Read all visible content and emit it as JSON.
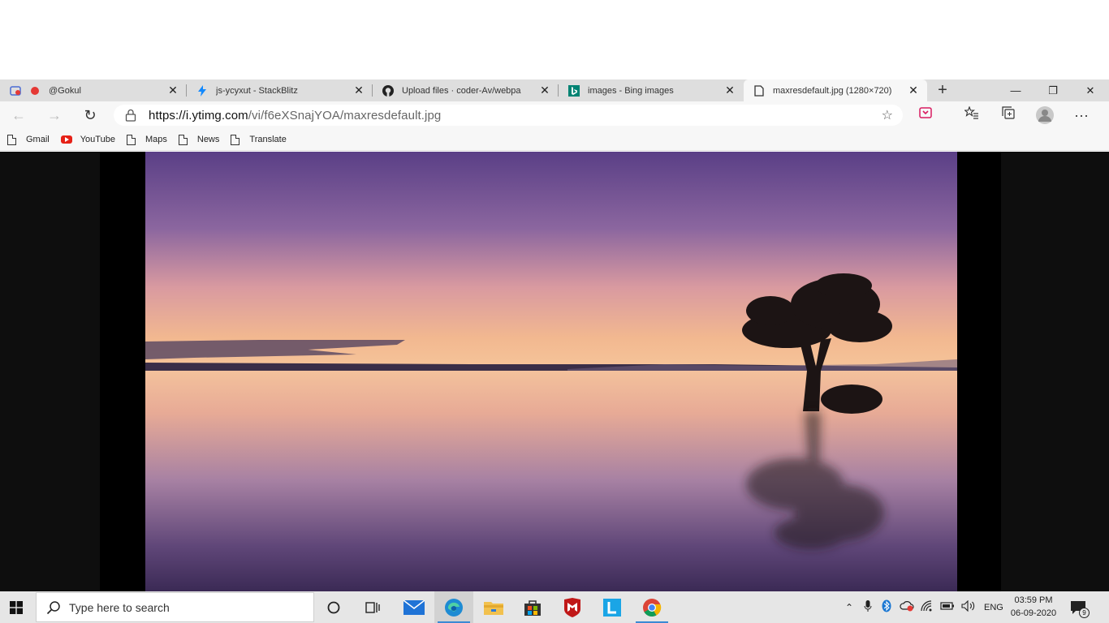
{
  "browser": {
    "tabs": [
      {
        "title": "@Gokul",
        "favicon": "recording-dot-icon"
      },
      {
        "title": "js-ycyxut - StackBlitz",
        "favicon": "stackblitz-bolt-icon"
      },
      {
        "title": "Upload files · coder-Av/webpa",
        "favicon": "github-icon"
      },
      {
        "title": "images - Bing images",
        "favicon": "bing-icon"
      },
      {
        "title": "maxresdefault.jpg (1280×720)",
        "favicon": "document-icon",
        "active": true
      }
    ],
    "url_host": "https://i.ytimg.com",
    "url_path": "/vi/f6eXSnajYOA/maxresdefault.jpg",
    "bookmarks": [
      {
        "label": "Gmail",
        "icon": "document-icon"
      },
      {
        "label": "YouTube",
        "icon": "youtube-icon"
      },
      {
        "label": "Maps",
        "icon": "document-icon"
      },
      {
        "label": "News",
        "icon": "document-icon"
      },
      {
        "label": "Translate",
        "icon": "document-icon"
      }
    ]
  },
  "taskbar": {
    "search_placeholder": "Type here to search",
    "language": "ENG",
    "time": "03:59 PM",
    "date": "06-09-2020",
    "notification_count": "9"
  },
  "colors": {
    "accent": "#3b8ad4",
    "tab_strip": "#dedede",
    "toolbar": "#f7f7f7",
    "taskbar": "#e6e6e6"
  }
}
